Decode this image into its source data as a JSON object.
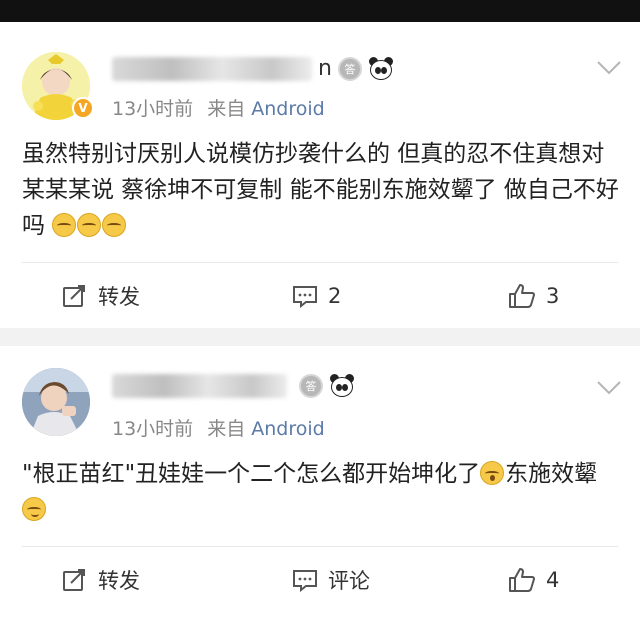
{
  "posts": [
    {
      "username_tail": "n",
      "medal_label": "答",
      "vip_label": "V",
      "time": "13小时前",
      "via": "来自",
      "source": "Android",
      "text": "虽然特别讨厌别人说模仿抄袭什么的 但真的忍不住真想对某某某说 蔡徐坤不可复制 能不能别东施效颦了 做自己不好吗",
      "emojis": [
        "grimace-emoji",
        "grimace-emoji",
        "grimace-emoji"
      ],
      "actions": {
        "repost": "转发",
        "comment": "2",
        "like": "3"
      }
    },
    {
      "username_tail": "",
      "medal_label": "答",
      "time": "13小时前",
      "via": "来自",
      "source": "Android",
      "text_part1": "\"根正苗红\"丑娃娃一个二个怎么都开始坤化了",
      "text_part2": "东施效颦",
      "actions": {
        "repost": "转发",
        "comment": "评论",
        "like": "4"
      }
    }
  ],
  "colors": {
    "background": "#f2f2f2",
    "card": "#ffffff",
    "source_link": "#5b7aa8",
    "meta_gray": "#888888",
    "vip_badge": "#f5a623"
  }
}
